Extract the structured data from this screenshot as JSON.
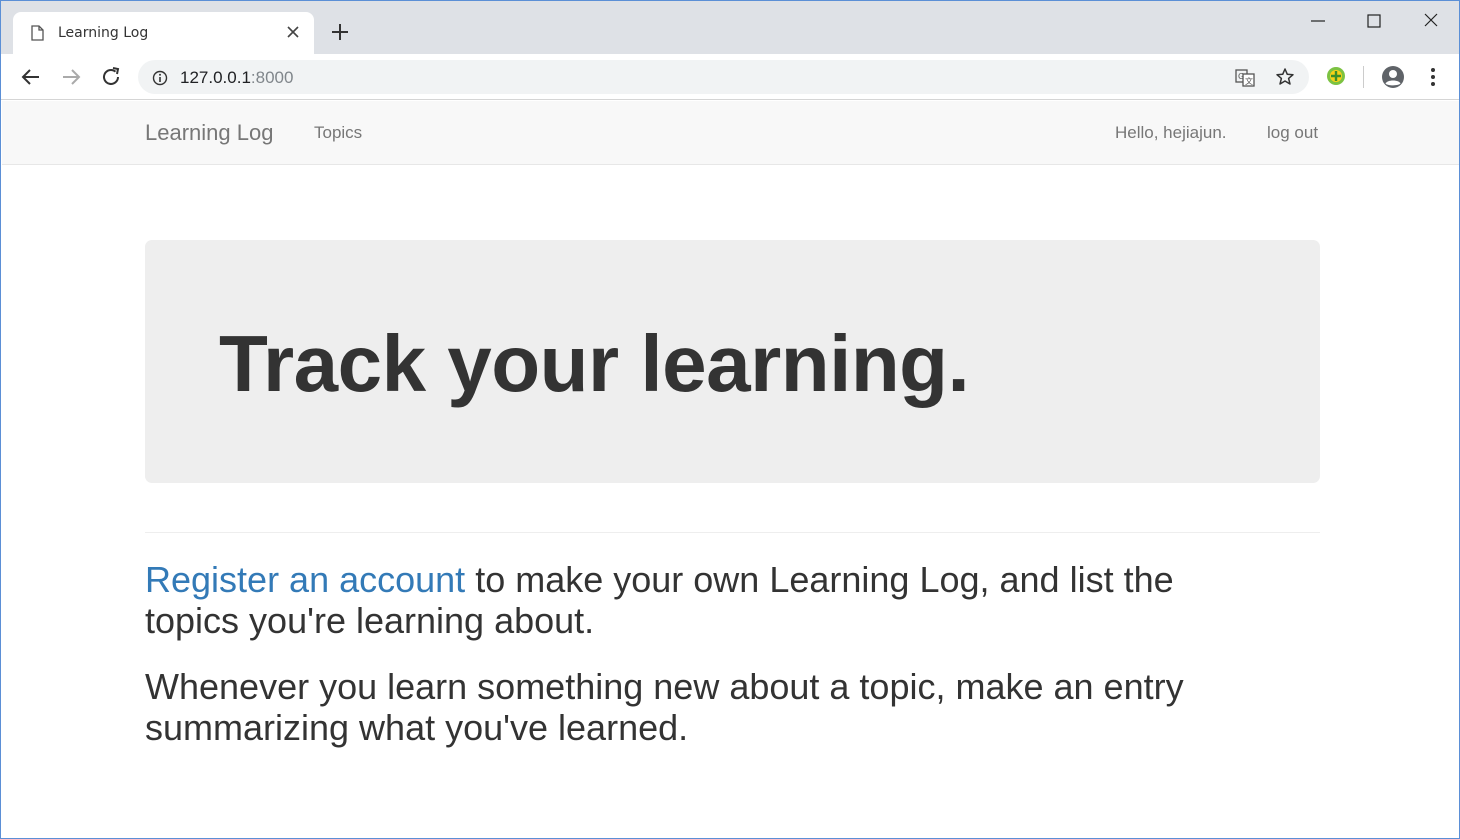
{
  "browser": {
    "tab_title": "Learning Log",
    "url_host": "127.0.0.1",
    "url_port": ":8000"
  },
  "navbar": {
    "brand": "Learning Log",
    "topics": "Topics",
    "greeting": "Hello, hejiajun.",
    "logout": "log out"
  },
  "jumbotron": {
    "title": "Track your learning."
  },
  "content": {
    "register_link": "Register an account",
    "paragraph1_rest": " to make your own Learning Log, and list the topics you're learning about.",
    "paragraph2": "Whenever you learn something new about a topic, make an entry summarizing what you've learned."
  },
  "colors": {
    "link": "#337ab7",
    "navbar_bg": "#f8f8f8",
    "jumbotron_bg": "#eeeeee",
    "text": "#333333"
  }
}
